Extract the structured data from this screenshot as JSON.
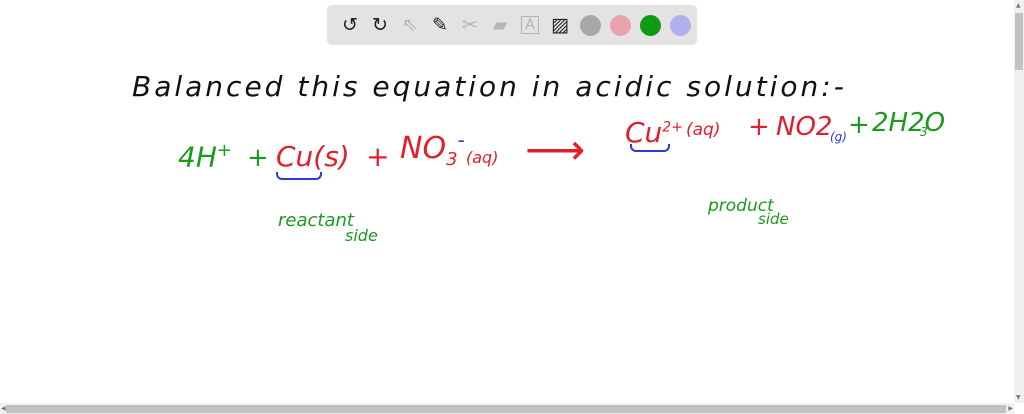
{
  "toolbar": {
    "tools": [
      {
        "name": "undo",
        "glyph": "↺"
      },
      {
        "name": "redo",
        "glyph": "↻"
      },
      {
        "name": "select",
        "glyph": "⇖"
      },
      {
        "name": "pen",
        "glyph": "✎"
      },
      {
        "name": "tools",
        "glyph": "✂"
      },
      {
        "name": "eraser",
        "glyph": "▰"
      },
      {
        "name": "text",
        "glyph": "A"
      },
      {
        "name": "image",
        "glyph": "▨"
      }
    ],
    "colors": [
      "#a8a8a8",
      "#e8a3ad",
      "#119911",
      "#b0b0ec"
    ]
  },
  "board": {
    "title": "Balanced this equation in acidic solution:-",
    "eq_hplus": "4H",
    "eq_hplus_sup": "+",
    "plus1": "+",
    "cu": "Cu(s)",
    "plus2": "+",
    "no3": "NO",
    "no3_sub": "3",
    "no3_sup": "-",
    "no3_state": "(aq)",
    "arrow": "⟶",
    "cu2": "Cu",
    "cu2_sup": "2+",
    "cu2_state": "(aq)",
    "plus3": "+",
    "no2": "NO2",
    "no2_state": "(g)",
    "plus4": "+",
    "water": "2H2O",
    "water_coef": "3",
    "reactant_label": "reactant",
    "reactant_label2": "side",
    "product_label": "product",
    "product_label2": "side"
  }
}
